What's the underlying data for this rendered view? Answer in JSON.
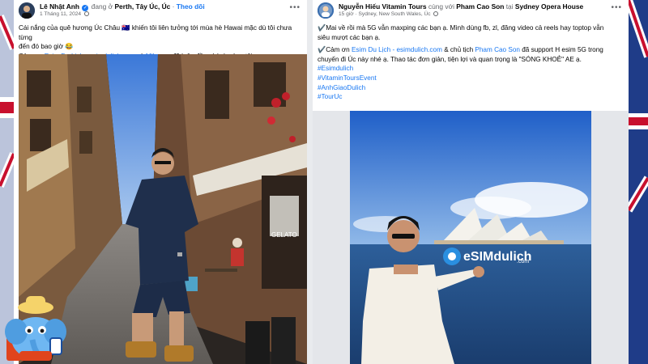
{
  "left_post": {
    "author": "Lê Nhật Anh",
    "location_prefix": "đang ở",
    "location": "Perth, Tây Úc, Úc",
    "separator": "·",
    "follow_label": "Theo dõi",
    "date": "1 Tháng 11, 2024",
    "text_line1": "Cái nắng của quê hương Úc Châu 🇦🇺 khiến tôi liên tưởng tới mùa hè Hawai mặc dù tôi chưa từng",
    "text_line2": "đến đó bao giờ 😂",
    "thanks_prefix": "Cảm ơn",
    "mention_esim": "Esim Du Lịch - esimdulich.com",
    "and_text": "và",
    "mention_mikenco": "Mikenco",
    "thanks_suffix": "đã luôn đồng hành cùng tôi",
    "photo_sign_text": "GELATO"
  },
  "right_post": {
    "author": "Nguyễn Hiếu Vitamin Tours",
    "with_text": "cùng với",
    "with_person": "Pham Cao Son",
    "at_text": "tại",
    "place": "Sydney Opera House",
    "time": "15 giờ",
    "separator": "·",
    "location": "Sydney, New South Wales, Úc",
    "line1": "✔️Mai về rồi mà 5G vẫn maxping các bạn ạ. Mình dùng fb, zl, đăng video cả reels hay toptop vẫn",
    "line2": "siêu mượt các bạn ạ.",
    "thanks_prefix": "✔️Cảm ơn",
    "mention_esim": "Esim Du Lịch - esimdulich.com",
    "thanks_mid": "& chủ tịch",
    "mention_son": "Pham Cao Son",
    "thanks_rest": "đã support H esim 5G trong",
    "line4": "chuyến đi Úc này nhé ạ. Thao tác đơn giản, tiện lợi và quan trọng là \"SÓNG KHOẺ\" AE ạ.",
    "hashtags": [
      "#Esimdulich",
      "#VitaminToursEvent",
      "#AnhGiaoDulich",
      "#TourUc"
    ],
    "photo_brand": "eSIMdulich",
    "photo_brand_sub": ".com"
  },
  "icons": {
    "verified": "verified-badge-icon",
    "globe": "globe-icon",
    "more": "more-options-icon"
  },
  "colors": {
    "link": "#1877f2",
    "text": "#050505",
    "muted": "#65676b",
    "background": "#1f3c88"
  }
}
